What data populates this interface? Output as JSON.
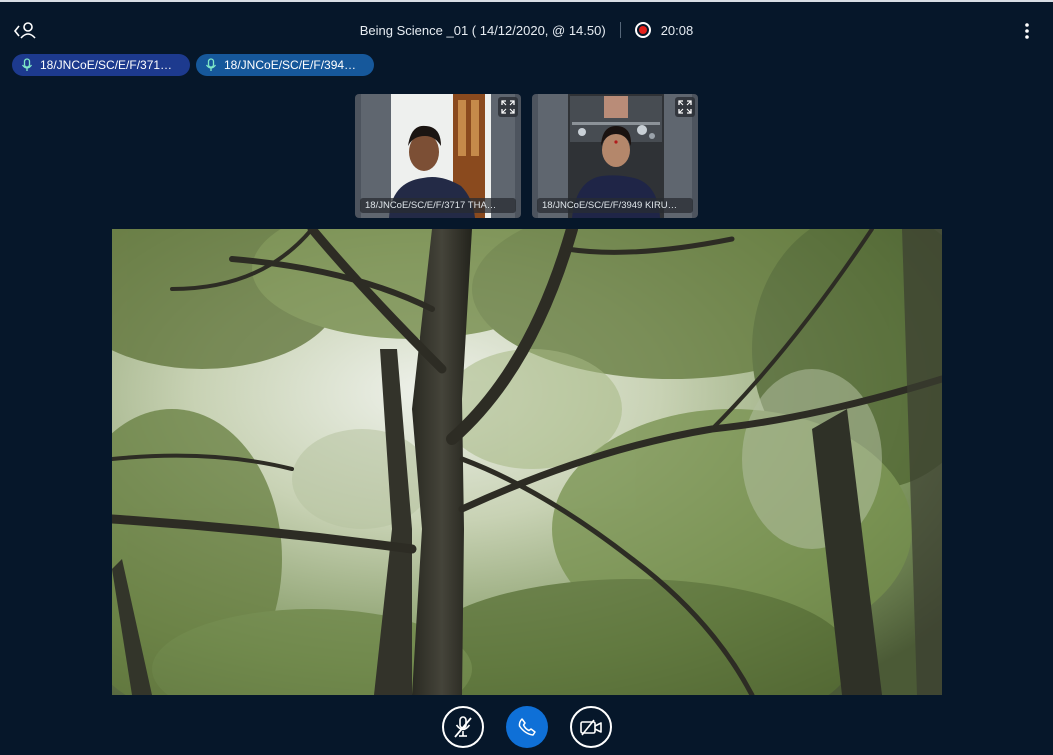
{
  "header": {
    "meeting_title": "Being Science _01 ( 14/12/2020, @ 14.50)",
    "recording_time": "20:08",
    "users_icon": "user-list-toggle-icon",
    "options_icon": "vertical-dots-icon"
  },
  "talkers": [
    {
      "label": "18/JNCoE/SC/E/F/371…",
      "icon": "microphone-icon"
    },
    {
      "label": "18/JNCoE/SC/E/F/394…",
      "icon": "microphone-icon"
    }
  ],
  "webcams": [
    {
      "label": "18/JNCoE/SC/E/F/3717 THA…",
      "icon": "fullscreen-icon"
    },
    {
      "label": "18/JNCoE/SC/E/F/3949 KIRU…",
      "icon": "fullscreen-icon"
    }
  ],
  "controls": {
    "mute": "muted-microphone-icon",
    "leave_audio": "phone-icon",
    "camera": "camera-icon"
  },
  "colors": {
    "background": "#06172a",
    "recording": "#e3201b",
    "leave_button": "#0f70d7"
  }
}
